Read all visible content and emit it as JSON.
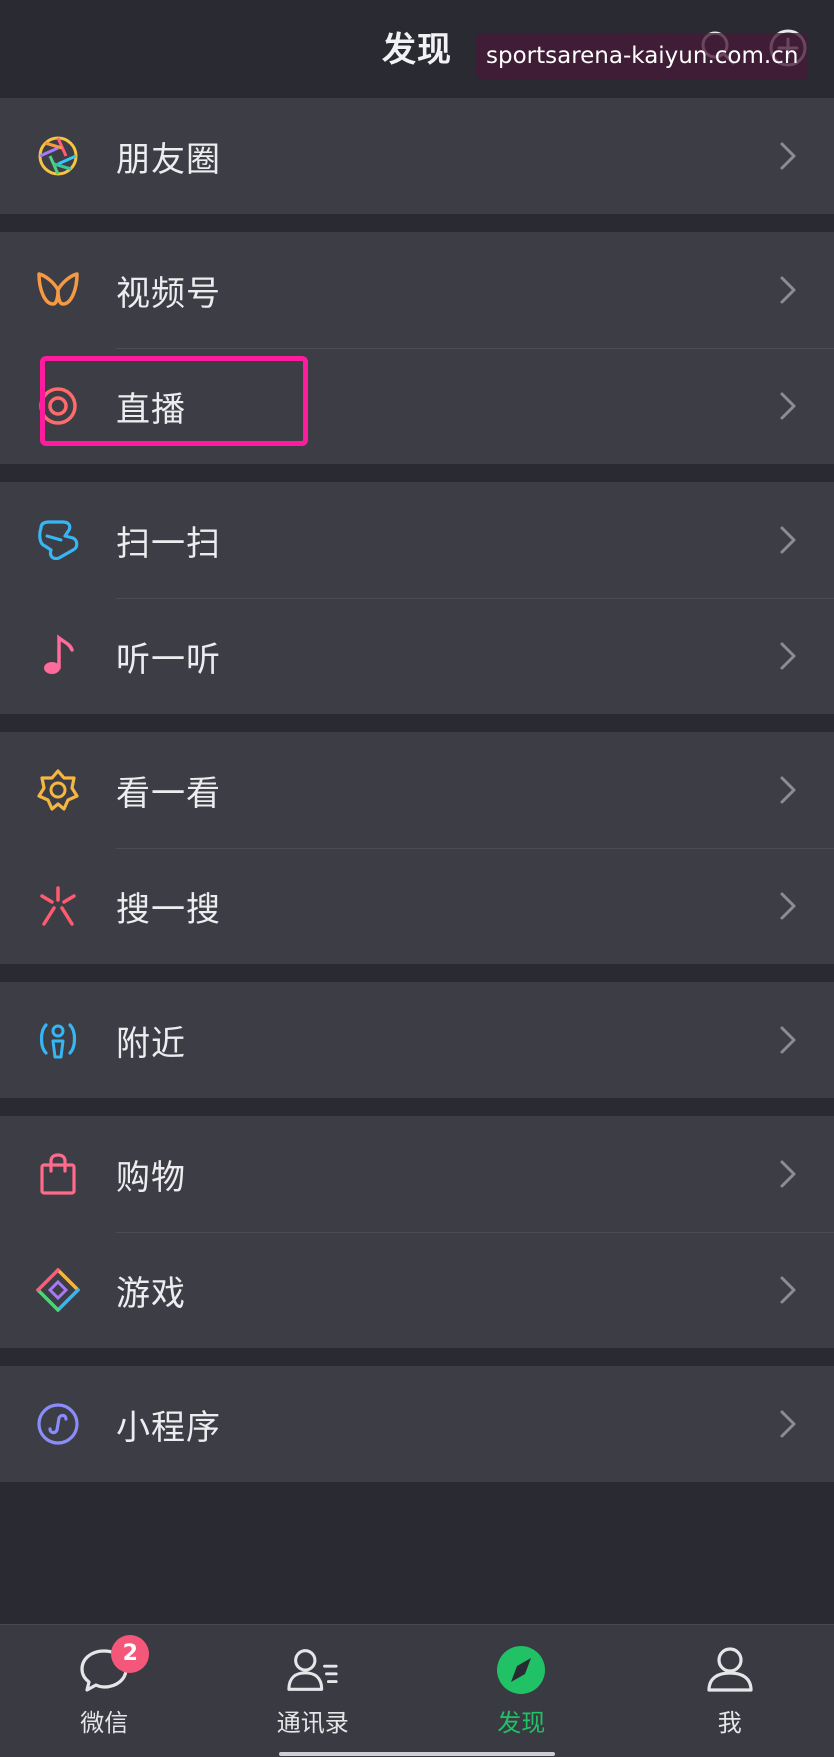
{
  "header": {
    "title": "发现",
    "watermark": "sportsarena-kaiyun.com.cn"
  },
  "menu": {
    "groups": [
      {
        "items": [
          {
            "label": "朋友圈",
            "icon": "moments-aperture-icon"
          }
        ]
      },
      {
        "items": [
          {
            "label": "视频号",
            "icon": "channels-icon"
          },
          {
            "label": "直播",
            "icon": "live-icon"
          }
        ]
      },
      {
        "items": [
          {
            "label": "扫一扫",
            "icon": "scan-icon"
          },
          {
            "label": "听一听",
            "icon": "music-note-icon"
          }
        ]
      },
      {
        "items": [
          {
            "label": "看一看",
            "icon": "top-stories-icon"
          },
          {
            "label": "搜一搜",
            "icon": "search-sparkle-icon"
          }
        ]
      },
      {
        "items": [
          {
            "label": "附近",
            "icon": "nearby-icon"
          }
        ]
      },
      {
        "items": [
          {
            "label": "购物",
            "icon": "shopping-bag-icon"
          },
          {
            "label": "游戏",
            "icon": "game-icon"
          }
        ]
      },
      {
        "items": [
          {
            "label": "小程序",
            "icon": "mini-program-icon"
          }
        ]
      }
    ]
  },
  "tabbar": {
    "tabs": [
      {
        "label": "微信",
        "icon": "chat-bubble-icon",
        "badge": "2"
      },
      {
        "label": "通讯录",
        "icon": "contacts-icon"
      },
      {
        "label": "发现",
        "icon": "compass-icon",
        "active": true
      },
      {
        "label": "我",
        "icon": "profile-icon"
      }
    ]
  },
  "colors": {
    "background": "#2a2a33",
    "row_background": "#3d3d45",
    "accent_green": "#21c165",
    "highlight_pink": "#ff1b9e",
    "badge_red": "#f5577a"
  }
}
